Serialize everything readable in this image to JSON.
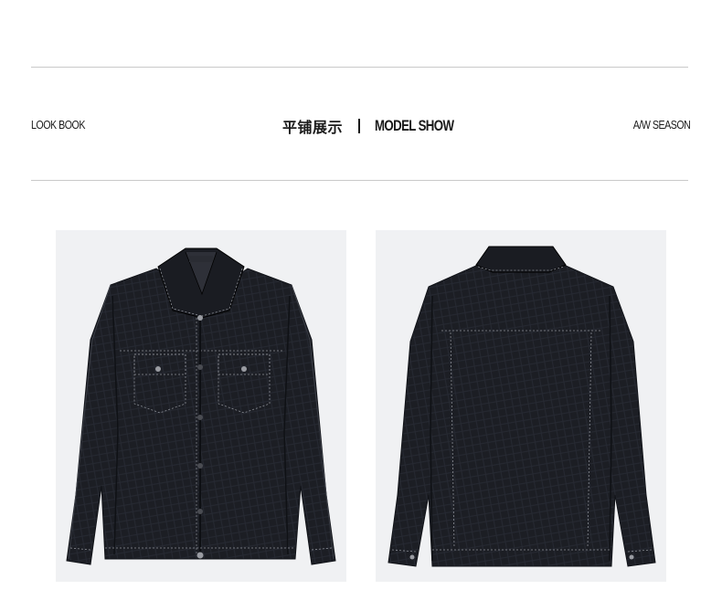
{
  "header": {
    "left_label": "LOOK BOOK",
    "title_cn": "平铺展示",
    "title_en": "MODEL SHOW",
    "right_label": "A/W SEASON"
  },
  "products": {
    "front_view": {
      "view": "front"
    },
    "back_view": {
      "view": "back"
    }
  },
  "colors": {
    "jacket": "#1c1e24",
    "stitch": "#8a8d94",
    "panel_bg": "#f0f1f3",
    "rule": "#c9c9c9"
  }
}
